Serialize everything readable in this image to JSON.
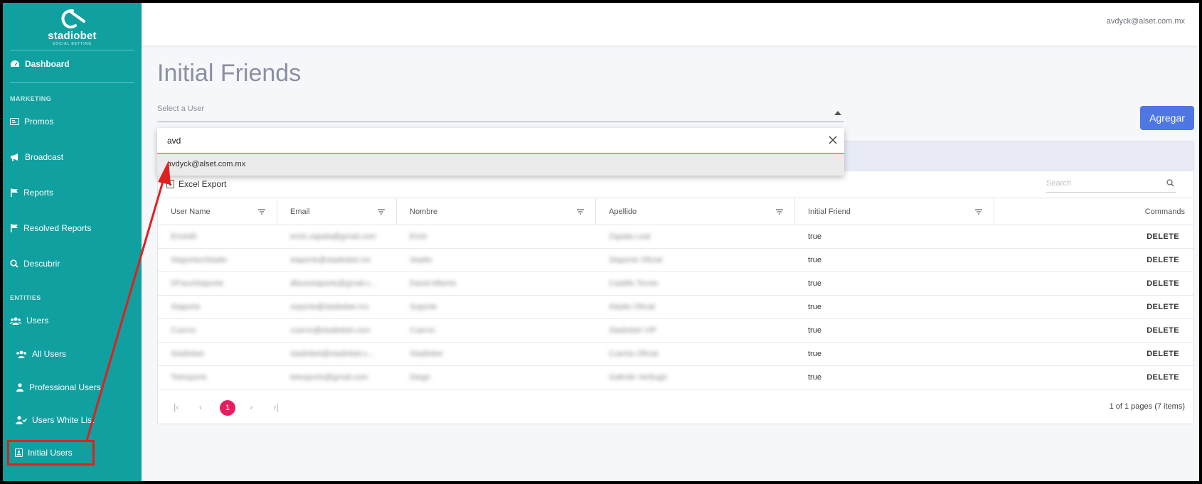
{
  "brand": {
    "name": "stadiobet",
    "tagline": "SOCIAL BETTING"
  },
  "header": {
    "user_email": "avdyck@alset.com.mx"
  },
  "sidebar": {
    "dashboard": "Dashboard",
    "marketing_label": "MARKETING",
    "promos": "Promos",
    "broadcast": "Broadcast",
    "reports": "Reports",
    "resolved_reports": "Resolved Reports",
    "descubrir": "Descubrir",
    "entities_label": "ENTITIES",
    "users": "Users",
    "all_users": "All Users",
    "professional_users": "Professional Users",
    "users_white_list": "Users White List",
    "initial_users": "Initial Users"
  },
  "main": {
    "title": "Initial Friends",
    "select_label": "Select a User",
    "add_button": "Agregar",
    "dropdown": {
      "search_value": "avd",
      "option": "avdyck@alset.com.mx"
    },
    "toolbar": {
      "excel_export": "Excel Export",
      "search_placeholder": "Search"
    },
    "columns": [
      "User Name",
      "Email",
      "Nombre",
      "Apellido",
      "Initial Friend",
      "Commands"
    ],
    "rows": [
      {
        "username": "Erickd0",
        "email": "erick.zapata@gmail.com",
        "nombre": "Erick",
        "apellido": "Zapata Leal",
        "initial": "true",
        "cmd": "DELETE"
      },
      {
        "username": "StaporteoStadio",
        "email": "staporte@stadiobet.mx",
        "nombre": "Stadio",
        "apellido": "Staporte Oficial",
        "initial": "true",
        "cmd": "DELETE"
      },
      {
        "username": "DFaceStaporte",
        "email": "dfacestaporte@gmail.c...",
        "nombre": "David Alberto",
        "apellido": "Castillo Torres",
        "initial": "true",
        "cmd": "DELETE"
      },
      {
        "username": "Staporte",
        "email": "soporte@stadiobet.mx",
        "nombre": "Soporte",
        "apellido": "Stadio Oficial",
        "initial": "true",
        "cmd": "DELETE"
      },
      {
        "username": "Cuervo",
        "email": "cuervo@stadiobet.com",
        "nombre": "Cuervo",
        "apellido": "Stadiobet VIP",
        "initial": "true",
        "cmd": "DELETE"
      },
      {
        "username": "Stadiobet",
        "email": "stadiobet@stadiobet.c...",
        "nombre": "Stadiobet",
        "apellido": "Cuenta Oficial",
        "initial": "true",
        "cmd": "DELETE"
      },
      {
        "username": "Totosports",
        "email": "totosports@gmail.com",
        "nombre": "Diego",
        "apellido": "Galindo Verbugo",
        "initial": "true",
        "cmd": "DELETE"
      }
    ],
    "pager": {
      "current": "1",
      "info": "1 of 1 pages (7 items)"
    }
  },
  "colors": {
    "sidebar": "#11a0a0",
    "primary_button": "#4e77e4",
    "pager_active": "#e61e5f",
    "annotation": "#e0201e"
  }
}
